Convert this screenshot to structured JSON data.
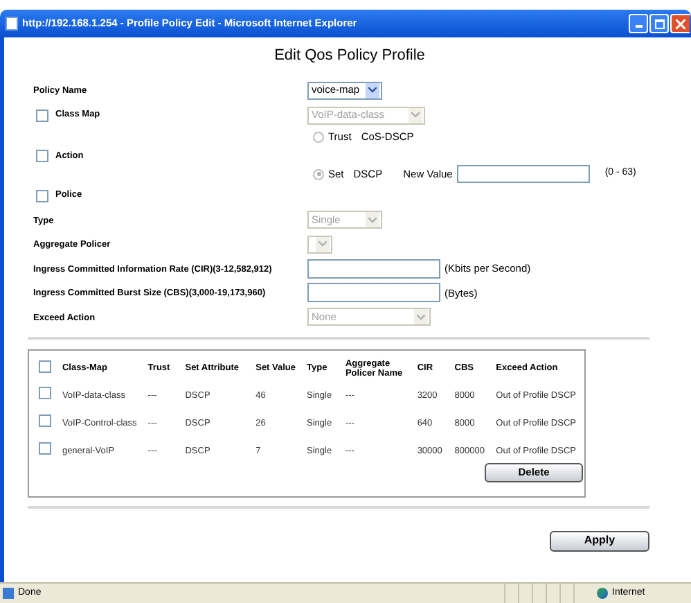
{
  "window": {
    "title": "http://192.168.1.254 - Profile Policy Edit - Microsoft Internet Explorer"
  },
  "heading": "Edit Qos Policy Profile",
  "policy_name": {
    "label": "Policy Name",
    "value": "voice-map",
    "disabled": false
  },
  "class_map": {
    "label": "Class Map",
    "checked": false,
    "value": "VoIP-data-class",
    "disabled": true
  },
  "action": {
    "label": "Action",
    "checked": false,
    "options": [
      {
        "label": "Trust",
        "detail": "CoS-DSCP",
        "selected": false
      },
      {
        "label": "Set",
        "detail": "DSCP",
        "selected": true
      }
    ],
    "new_value": {
      "label": "New Value",
      "range": "(0 - 63)"
    }
  },
  "police": {
    "label": "Police",
    "checked": false
  },
  "fields": [
    {
      "kind": "select",
      "label": "Type",
      "value": "Single",
      "disabled": true
    },
    {
      "kind": "select",
      "label": "Aggregate Policer",
      "disabled": true
    },
    {
      "kind": "input",
      "label": "Ingress Committed Information Rate (CIR)(3-12,582,912)",
      "unit": "(Kbits per Second)"
    },
    {
      "kind": "input",
      "label": "Ingress Committed Burst Size (CBS)(3,000-19,173,960)",
      "unit": "(Bytes)"
    },
    {
      "kind": "select",
      "label": "Exceed Action",
      "value": "None",
      "disabled": true
    }
  ],
  "table": {
    "header_checked": false,
    "columns": [
      "Class-Map",
      "Trust",
      "Set Attribute",
      "Set Value",
      "Type",
      "Aggregate Policer Name",
      "CIR",
      "CBS",
      "Exceed Action"
    ],
    "rows": [
      {
        "checked": false,
        "cells": [
          "VoIP-data-class",
          "---",
          "DSCP",
          "46",
          "Single",
          "---",
          "3200",
          "8000",
          "Out of Profile DSCP"
        ]
      },
      {
        "checked": false,
        "cells": [
          "VoIP-Control-class",
          "---",
          "DSCP",
          "26",
          "Single",
          "---",
          "640",
          "8000",
          "Out of Profile DSCP"
        ]
      },
      {
        "checked": false,
        "cells": [
          "general-VoIP",
          "---",
          "DSCP",
          "7",
          "Single",
          "---",
          "30000",
          "800000",
          "Out of Profile DSCP"
        ]
      }
    ]
  },
  "delete_button": "Delete",
  "apply_button": "Apply",
  "status_bar": {
    "text": "Done",
    "zone": "Internet"
  }
}
